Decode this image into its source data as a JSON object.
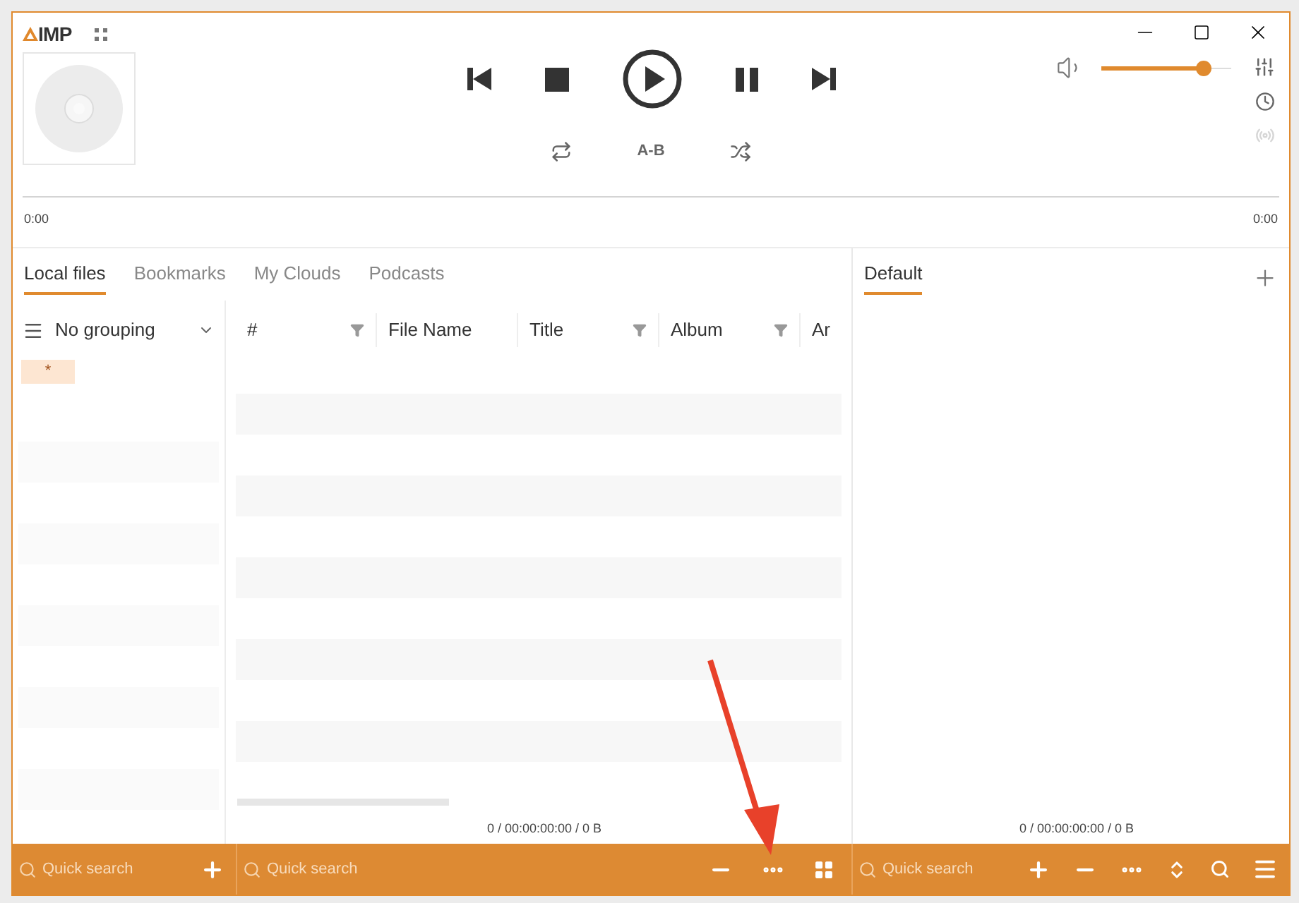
{
  "window": {
    "logo": "IMP"
  },
  "player": {
    "time_elapsed": "0:00",
    "time_total": "0:00",
    "volume": {
      "level": 0.78
    },
    "ab_label": "A-B",
    "broadcast": {
      "disabled": true
    }
  },
  "tabs": [
    {
      "label": "Local files",
      "selected": true
    },
    {
      "label": "Bookmarks",
      "selected": false
    },
    {
      "label": "My Clouds",
      "selected": false
    },
    {
      "label": "Podcasts",
      "selected": false
    }
  ],
  "grouping": {
    "label": "No grouping",
    "items": [
      {
        "label": "*",
        "selected": true
      }
    ]
  },
  "table": {
    "columns": [
      {
        "label": "#",
        "filter": true
      },
      {
        "label": "File Name",
        "filter": false
      },
      {
        "label": "Title",
        "filter": true
      },
      {
        "label": "Album",
        "filter": true
      },
      {
        "label": "Ar",
        "filter": false
      }
    ],
    "status": "0 / 00:00:00:00 / 0 B"
  },
  "playlist": {
    "tabs": [
      {
        "label": "Default",
        "selected": true
      }
    ],
    "status": "0 / 00:00:00:00 / 0 B"
  },
  "search_fields": [
    {
      "placeholder": "Quick search"
    },
    {
      "placeholder": "Quick search"
    },
    {
      "placeholder": "Quick search"
    }
  ]
}
